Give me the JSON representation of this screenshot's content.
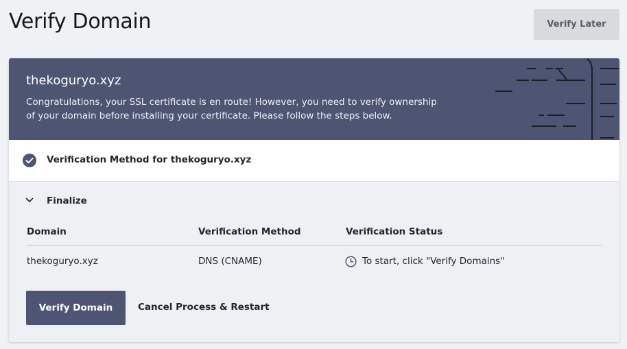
{
  "header": {
    "title": "Verify Domain",
    "verify_later_label": "Verify Later"
  },
  "banner": {
    "domain": "thekoguryo.xyz",
    "message": "Congratulations, your SSL certificate is en route! However, you need to verify ownership of your domain before installing your certificate. Please follow the steps below."
  },
  "method": {
    "label": "Verification Method for thekoguryo.xyz",
    "icon": "check-circle-icon"
  },
  "finalize": {
    "label": "Finalize",
    "columns": [
      "Domain",
      "Verification Method",
      "Verification Status"
    ],
    "rows": [
      {
        "domain": "thekoguryo.xyz",
        "method": "DNS (CNAME)",
        "status": "To start, click \"Verify Domains\"",
        "status_icon": "clock-icon"
      }
    ]
  },
  "actions": {
    "verify_domain_label": "Verify Domain",
    "cancel_label": "Cancel Process & Restart"
  },
  "colors": {
    "banner": "#4d5573",
    "primary_button": "#4d5573",
    "secondary_button": "#d8dade",
    "background": "#f0f1f4"
  }
}
